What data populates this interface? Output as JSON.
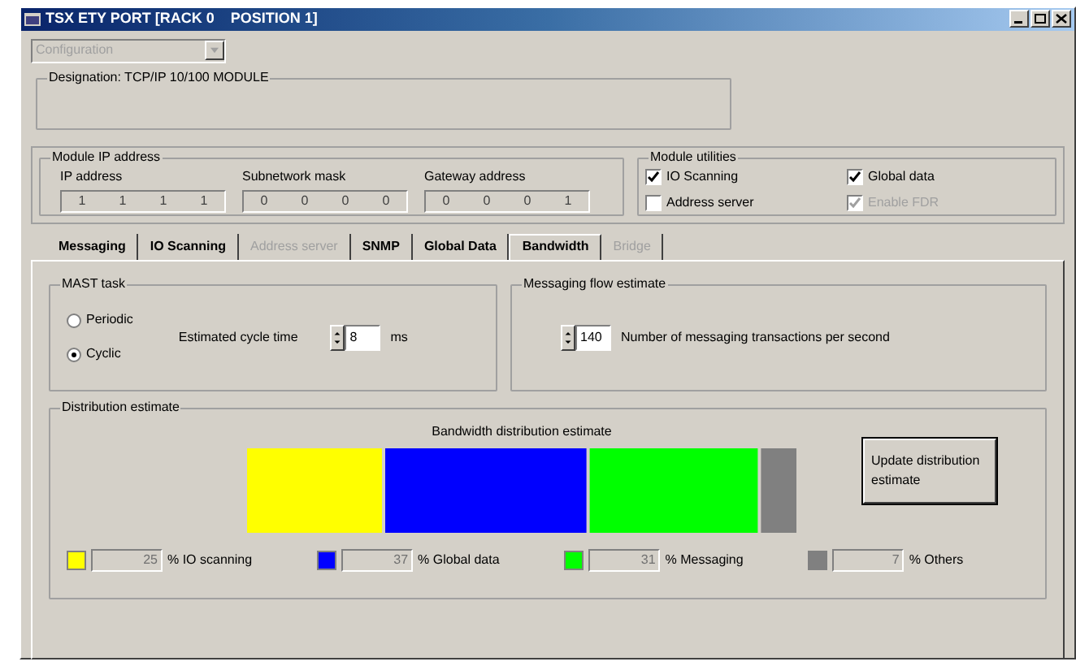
{
  "window": {
    "title": "TSX ETY PORT [RACK 0    POSITION 1]"
  },
  "mode_dropdown": {
    "value": "Configuration",
    "disabled": true
  },
  "designation": {
    "label": "Designation: TCP/IP 10/100 MODULE"
  },
  "module_ip": {
    "title": "Module IP address",
    "fields": [
      {
        "label": "IP address",
        "octets": [
          "1",
          "1",
          "1",
          "1"
        ]
      },
      {
        "label": "Subnetwork mask",
        "octets": [
          "0",
          "0",
          "0",
          "0"
        ]
      },
      {
        "label": "Gateway address",
        "octets": [
          "0",
          "0",
          "0",
          "1"
        ]
      }
    ]
  },
  "module_utilities": {
    "title": "Module utilities",
    "options": [
      {
        "label": "IO Scanning",
        "checked": true,
        "disabled": false
      },
      {
        "label": "Global data",
        "checked": true,
        "disabled": false
      },
      {
        "label": "Address server",
        "checked": false,
        "disabled": false
      },
      {
        "label": "Enable FDR",
        "checked": true,
        "disabled": true
      }
    ]
  },
  "tabs": [
    {
      "label": "Messaging",
      "selected": false,
      "disabled": false
    },
    {
      "label": "IO Scanning",
      "selected": false,
      "disabled": false
    },
    {
      "label": "Address server",
      "selected": false,
      "disabled": true
    },
    {
      "label": "SNMP",
      "selected": false,
      "disabled": false
    },
    {
      "label": "Global Data",
      "selected": false,
      "disabled": false
    },
    {
      "label": "Bandwidth",
      "selected": true,
      "disabled": false
    },
    {
      "label": "Bridge",
      "selected": false,
      "disabled": true
    }
  ],
  "mast_task": {
    "title": "MAST task",
    "modes": [
      {
        "label": "Periodic",
        "selected": false
      },
      {
        "label": "Cyclic",
        "selected": true
      }
    ],
    "cycle_label": "Estimated cycle time",
    "cycle_value": "8",
    "unit": "ms"
  },
  "messaging_flow": {
    "title": "Messaging flow estimate",
    "value": "140",
    "label": "Number of messaging transactions per second"
  },
  "distribution": {
    "title": "Distribution estimate",
    "update_button": "Update distribution estimate",
    "chart_title": "Bandwidth distribution estimate",
    "legend": [
      {
        "value": "25",
        "label": "% IO scanning",
        "color": "#ffff00"
      },
      {
        "value": "37",
        "label": "% Global data",
        "color": "#0000ff"
      },
      {
        "value": "31",
        "label": "% Messaging",
        "color": "#00ff00"
      },
      {
        "value": "7",
        "label": "% Others",
        "color": "#808080"
      }
    ]
  }
}
